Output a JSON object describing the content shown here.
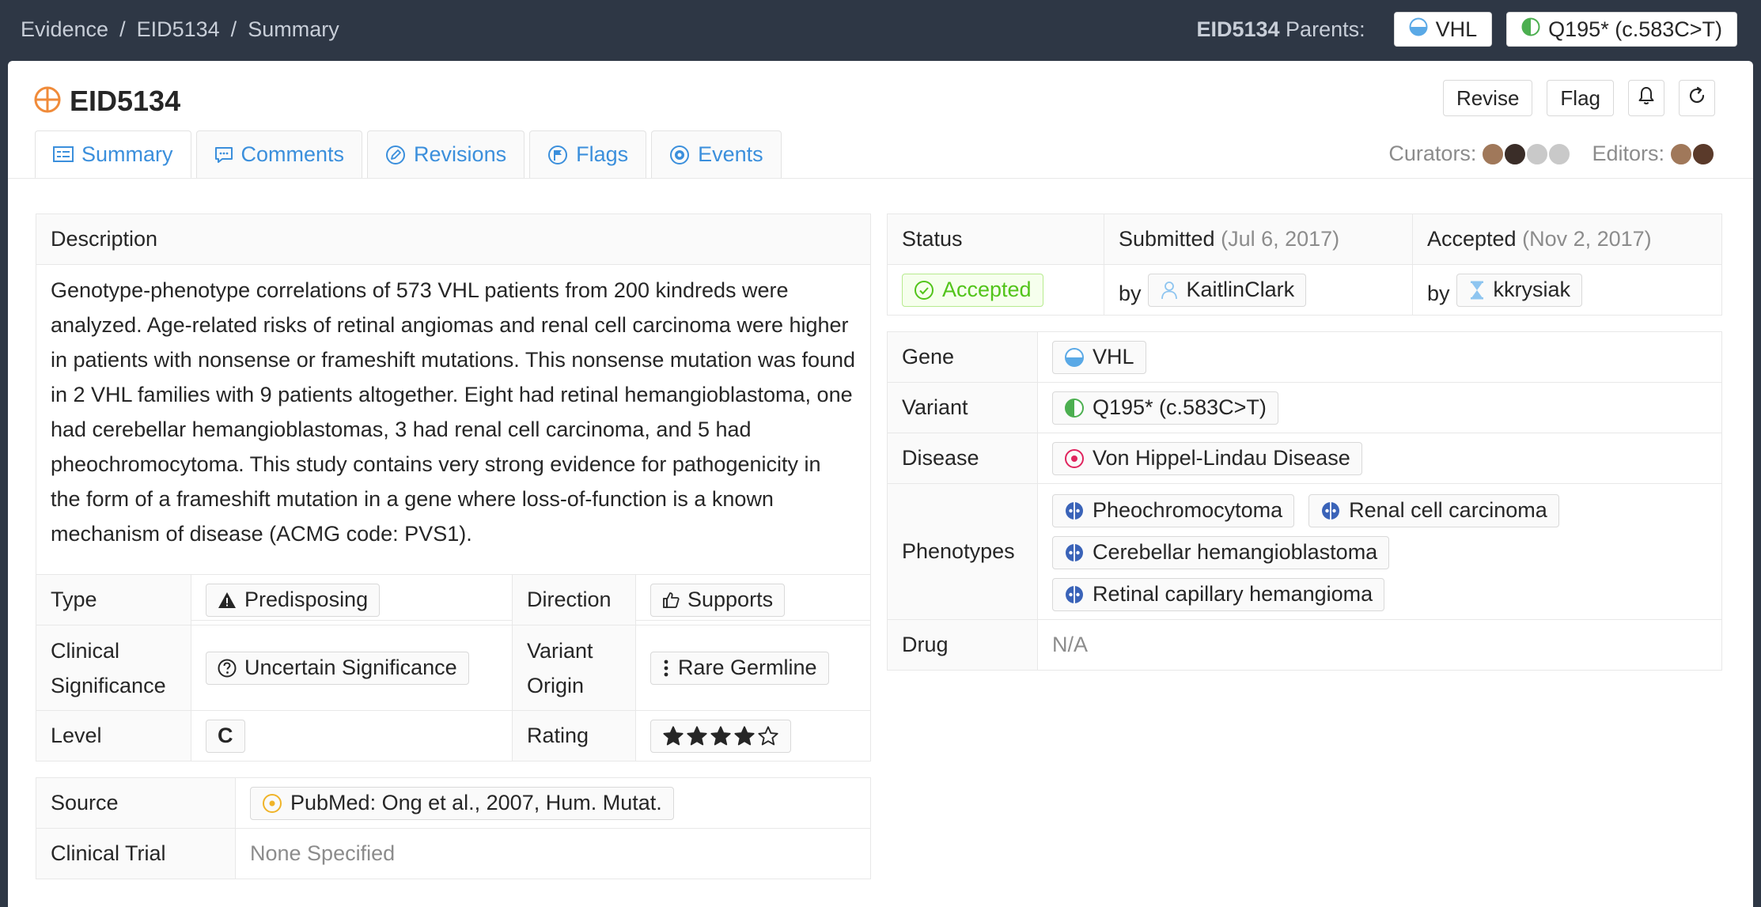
{
  "breadcrumb": {
    "items": [
      "Evidence",
      "EID5134",
      "Summary"
    ],
    "separator": "/"
  },
  "parents": {
    "label_id": "EID5134",
    "label_text": "Parents:",
    "gene": "VHL",
    "variant": "Q195* (c.583C>T)"
  },
  "title": "EID5134",
  "actions": {
    "revise": "Revise",
    "flag": "Flag",
    "subscribe_icon": "bell-icon",
    "refresh_icon": "refresh-icon"
  },
  "tabs": [
    {
      "label": "Summary",
      "icon": "summary-icon",
      "active": true
    },
    {
      "label": "Comments",
      "icon": "comment-icon"
    },
    {
      "label": "Revisions",
      "icon": "edit-icon"
    },
    {
      "label": "Flags",
      "icon": "flag-icon"
    },
    {
      "label": "Events",
      "icon": "events-icon"
    }
  ],
  "people": {
    "curators_label": "Curators:",
    "editors_label": "Editors:"
  },
  "description": {
    "heading": "Description",
    "text": "Genotype-phenotype correlations of 573 VHL patients from 200 kindreds were analyzed. Age-related risks of retinal angiomas and renal cell carcinoma were higher in patients with nonsense or frameshift mutations. This nonsense mutation was found in 2 VHL families with 9 patients altogether. Eight had retinal hemangioblastoma, one had cerebellar hemangioblastomas, 3 had renal cell carcinoma, and 5 had pheochromocytoma. This study contains very strong evidence for pathogenicity in the form of a frameshift mutation in a gene where loss-of-function is a known mechanism of disease (ACMG code: PVS1)."
  },
  "attributes": {
    "type_label": "Type",
    "type_value": "Predisposing",
    "direction_label": "Direction",
    "direction_value": "Supports",
    "clinsig_label": "Clinical Significance",
    "clinsig_value": "Uncertain Significance",
    "origin_label": "Variant Origin",
    "origin_value": "Rare Germline",
    "level_label": "Level",
    "level_value": "C",
    "rating_label": "Rating",
    "rating_value": 4,
    "rating_max": 5
  },
  "source": {
    "source_label": "Source",
    "source_value": "PubMed: Ong et al., 2007, Hum. Mutat.",
    "trial_label": "Clinical Trial",
    "trial_value": "None Specified"
  },
  "status": {
    "status_label": "Status",
    "status_value": "Accepted",
    "submitted_label": "Submitted",
    "submitted_date": "(Jul 6, 2017)",
    "accepted_label": "Accepted",
    "accepted_date": "(Nov 2, 2017)",
    "by": "by",
    "submitter": "KaitlinClark",
    "acceptor": "kkrysiak"
  },
  "entities": {
    "gene_label": "Gene",
    "gene_value": "VHL",
    "variant_label": "Variant",
    "variant_value": "Q195* (c.583C>T)",
    "disease_label": "Disease",
    "disease_value": "Von Hippel-Lindau Disease",
    "phenotypes_label": "Phenotypes",
    "phenotypes": [
      "Pheochromocytoma",
      "Renal cell carcinoma",
      "Cerebellar hemangioblastoma",
      "Retinal capillary hemangioma"
    ],
    "drug_label": "Drug",
    "drug_value": "N/A"
  },
  "colors": {
    "accent": "#3b8fdc",
    "accepted": "#52c41a",
    "evidence": "#f08b3a",
    "disease": "#e0245e",
    "phenotype": "#3a63b8",
    "header": "#2e3745"
  }
}
